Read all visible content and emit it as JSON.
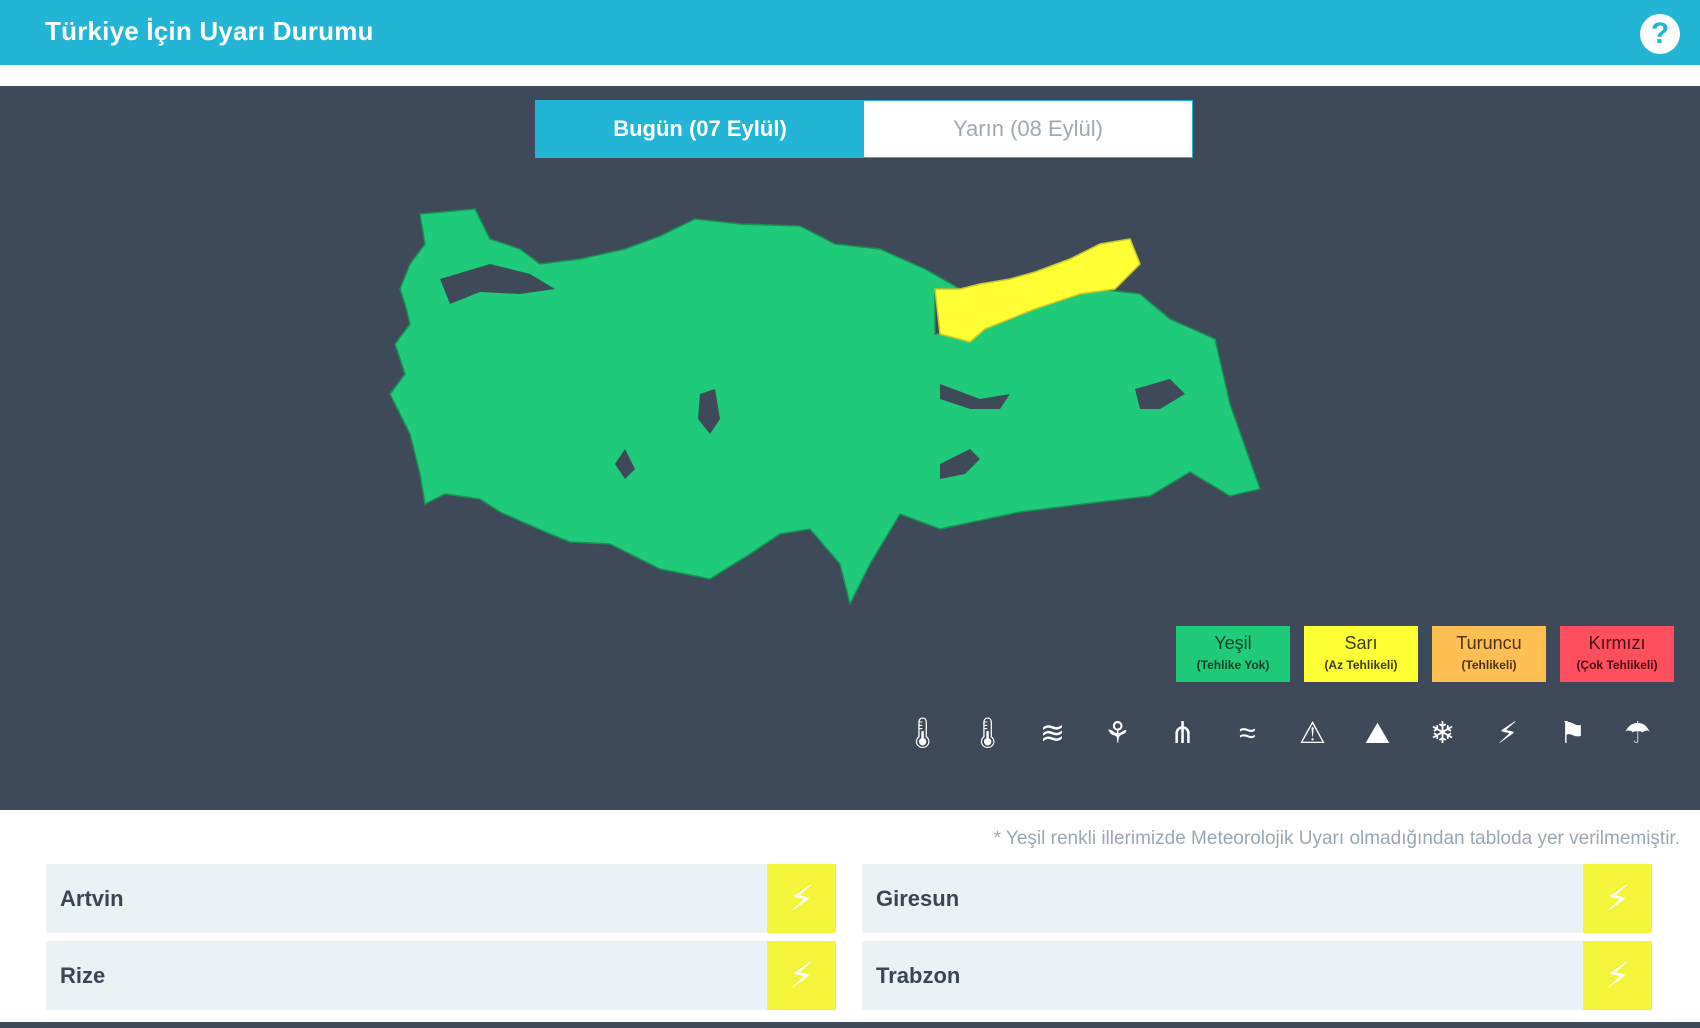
{
  "header": {
    "title": "Türkiye İçin Uyarı Durumu",
    "help_icon": "help-icon"
  },
  "tabs": [
    {
      "label": "Bugün (07 Eylül)",
      "active": true
    },
    {
      "label": "Yarın (08 Eylül)",
      "active": false
    }
  ],
  "map": {
    "colors": {
      "green": "#1fcb78",
      "yellow": "#ffff33",
      "background": "#3e4a59"
    },
    "highlighted_region": "yellow"
  },
  "legend": [
    {
      "label": "Yeşil",
      "sub": "(Tehlike Yok)",
      "color": "#1fcb78"
    },
    {
      "label": "Sarı",
      "sub": "(Az Tehlikeli)",
      "color": "#ffff33"
    },
    {
      "label": "Turuncu",
      "sub": "(Tehlikeli)",
      "color": "#ffbf52"
    },
    {
      "label": "Kırmızı",
      "sub": "(Çok Tehlikeli)",
      "color": "#ff4f5f"
    }
  ],
  "hazard_icons": [
    "low-temperature-icon",
    "high-temperature-icon",
    "fog-icon",
    "dust-icon",
    "icing-icon",
    "wind-icon",
    "avalanche-icon",
    "landslide-icon",
    "snow-icon",
    "thunderstorm-icon",
    "windsock-icon",
    "rain-icon"
  ],
  "note": "* Yeşil renkli illerimizde Meteorolojik Uyarı olmadığından tabloda yer verilmemiştir.",
  "warnings": [
    {
      "province": "Artvin",
      "icon": "thunderstorm-icon",
      "color": "#f4f43b"
    },
    {
      "province": "Giresun",
      "icon": "thunderstorm-icon",
      "color": "#f4f43b"
    },
    {
      "province": "Rize",
      "icon": "thunderstorm-icon",
      "color": "#f4f43b"
    },
    {
      "province": "Trabzon",
      "icon": "thunderstorm-icon",
      "color": "#f4f43b"
    }
  ]
}
